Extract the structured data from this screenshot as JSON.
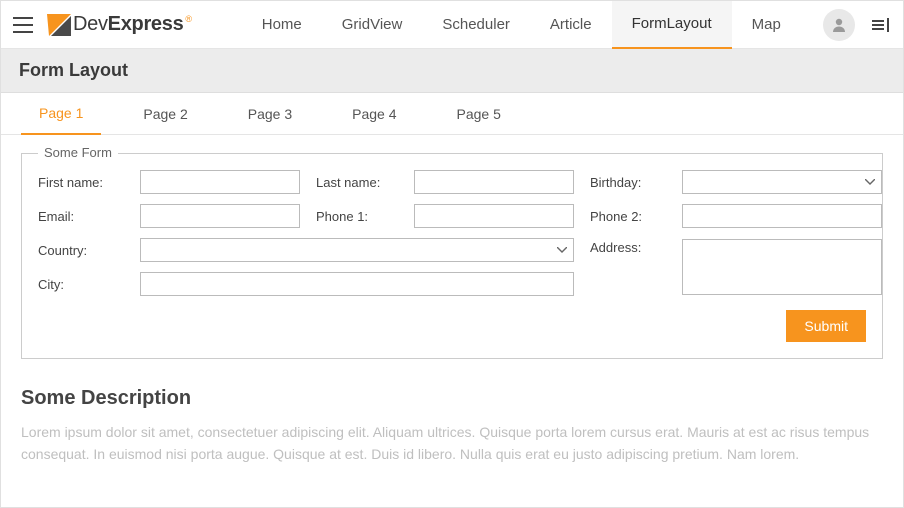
{
  "brand": {
    "text_prefix": "Dev",
    "text_suffix": "Express"
  },
  "nav": {
    "items": [
      {
        "label": "Home"
      },
      {
        "label": "GridView"
      },
      {
        "label": "Scheduler"
      },
      {
        "label": "Article"
      },
      {
        "label": "FormLayout"
      },
      {
        "label": "Map"
      }
    ]
  },
  "page_title": "Form Layout",
  "tabs": {
    "items": [
      {
        "label": "Page 1"
      },
      {
        "label": "Page 2"
      },
      {
        "label": "Page 3"
      },
      {
        "label": "Page 4"
      },
      {
        "label": "Page 5"
      }
    ]
  },
  "form": {
    "legend": "Some Form",
    "labels": {
      "first_name": "First name:",
      "last_name": "Last name:",
      "birthday": "Birthday:",
      "email": "Email:",
      "phone1": "Phone 1:",
      "phone2": "Phone 2:",
      "country": "Country:",
      "address": "Address:",
      "city": "City:"
    },
    "values": {
      "first_name": "",
      "last_name": "",
      "birthday": "",
      "email": "",
      "phone1": "",
      "phone2": "",
      "country": "",
      "address": "",
      "city": ""
    },
    "submit_label": "Submit"
  },
  "description": {
    "title": "Some Description",
    "body": "Lorem ipsum dolor sit amet, consectetuer adipiscing elit. Aliquam ultrices. Quisque porta lorem cursus erat. Mauris at est ac risus tempus consequat. In euismod nisi porta augue. Quisque at est. Duis id libero. Nulla quis erat eu justo adipiscing pretium. Nam lorem."
  }
}
